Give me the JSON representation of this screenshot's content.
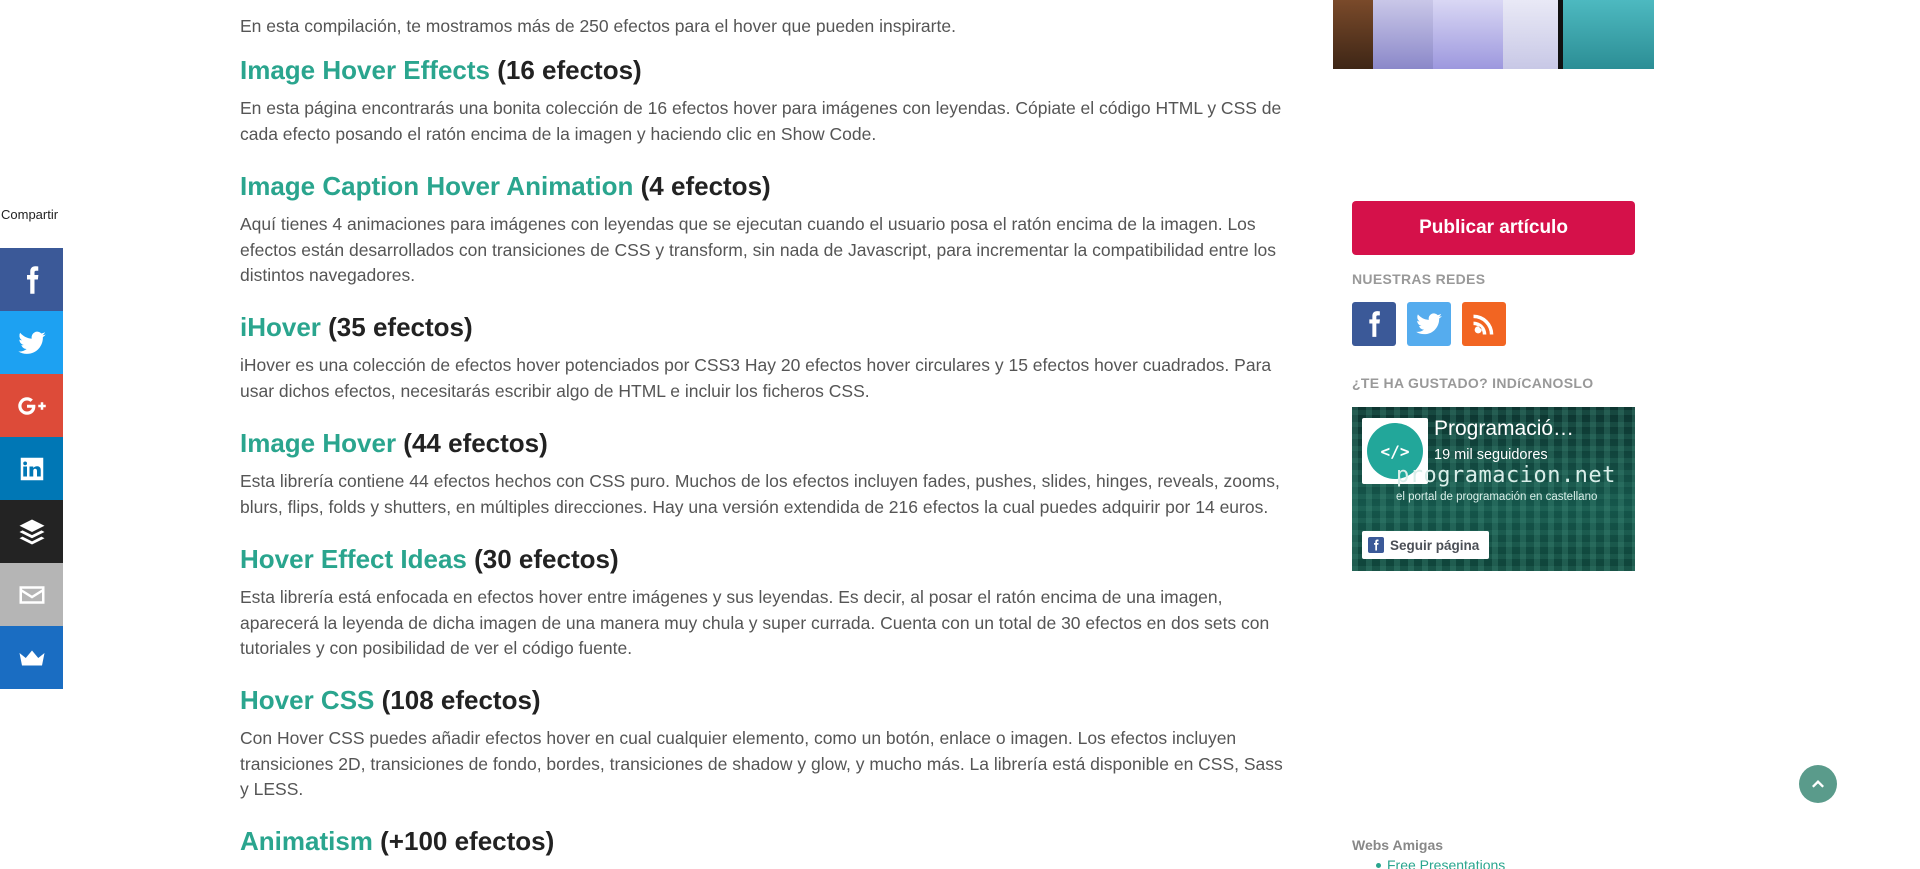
{
  "share": {
    "label": "Compartir",
    "buttons": [
      {
        "network": "facebook",
        "icon": "facebook-icon",
        "color": "#3b5998"
      },
      {
        "network": "twitter",
        "icon": "twitter-icon",
        "color": "#1da1f2"
      },
      {
        "network": "google-plus",
        "icon": "google-plus-icon",
        "color": "#dd4b39"
      },
      {
        "network": "linkedin",
        "icon": "linkedin-icon",
        "color": "#0077b5"
      },
      {
        "network": "buffer",
        "icon": "buffer-icon",
        "color": "#232323"
      },
      {
        "network": "email",
        "icon": "email-icon",
        "color": "#b5b5b5"
      },
      {
        "network": "sumome",
        "icon": "crown-icon",
        "color": "#1a6dc2"
      }
    ]
  },
  "main": {
    "intro": "En esta compilación, te mostramos más de 250 efectos para el hover que pueden inspirarte.",
    "sections": [
      {
        "link": "Image Hover Effects",
        "count": " (16 efectos)",
        "text": "En esta página encontrarás una bonita colección de 16 efectos hover para imágenes con leyendas. Cópiate el código HTML y CSS de cada efecto posando el ratón encima de la imagen y haciendo clic en Show Code."
      },
      {
        "link": "Image Caption Hover Animation",
        "count": " (4 efectos)",
        "text": "Aquí tienes 4 animaciones para imágenes con leyendas que se ejecutan cuando el usuario posa el ratón encima de la imagen. Los efectos están desarrollados con transiciones de CSS y transform, sin nada de Javascript, para incrementar la compatibilidad entre los distintos navegadores."
      },
      {
        "link": "iHover",
        "count": " (35 efectos)",
        "text": "iHover es una colección de efectos hover potenciados por CSS3 Hay 20 efectos hover circulares y 15 efectos hover cuadrados. Para usar dichos efectos, necesitarás escribir algo de HTML e incluir los ficheros CSS."
      },
      {
        "link": "Image Hover",
        "count": " (44 efectos)",
        "text": "Esta librería contiene 44 efectos hechos con CSS puro. Muchos de los efectos incluyen fades, pushes, slides, hinges, reveals, zooms, blurs, flips, folds y shutters, en múltiples direcciones. Hay una versión extendida de 216 efectos la cual puedes adquirir por 14 euros."
      },
      {
        "link": "Hover Effect Ideas",
        "count": " (30 efectos)",
        "text": "Esta librería está enfocada en efectos hover entre imágenes y sus leyendas. Es decir, al posar el ratón encima de una imagen, aparecerá la leyenda de dicha imagen de una manera muy chula y super currada. Cuenta con un total de 30 efectos en dos sets con tutoriales y con posibilidad de ver el código fuente."
      },
      {
        "link": "Hover CSS",
        "count": " (108 efectos)",
        "text": "Con Hover CSS puedes añadir efectos hover en cual cualquier elemento, como un botón, enlace o imagen. Los efectos incluyen transiciones 2D, transiciones de fondo, bordes, transiciones de shadow y glow, y mucho más. La librería está disponible en CSS, Sass y LESS."
      },
      {
        "link": "Animatism",
        "count": " (+100 efectos)",
        "text": ""
      }
    ]
  },
  "sidebar": {
    "publish_label": "Publicar artículo",
    "networks_label": "NUESTRAS REDES",
    "networks": [
      {
        "icon": "facebook-icon",
        "color": "#3b5998"
      },
      {
        "icon": "twitter-icon",
        "color": "#55acee"
      },
      {
        "icon": "rss-icon",
        "color": "#f26522"
      }
    ],
    "liked_label": "¿TE HA GUSTADO? INDíCANOSLO",
    "fb_widget": {
      "title": "Programació…",
      "followers": "19 mil seguidores",
      "site": "programacion.net",
      "tagline": "el portal de programación en castellano",
      "follow_label": "Seguir página",
      "logo_text": "</>"
    },
    "friends_title": "Webs Amigas",
    "friends": [
      "Free Presentations"
    ]
  },
  "colors": {
    "link": "#2aa58e",
    "publish": "#d5114a",
    "scroll_top": "#5a9b8b"
  }
}
